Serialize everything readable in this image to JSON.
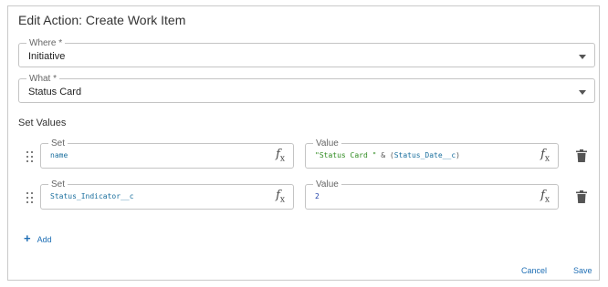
{
  "dialog": {
    "title": "Edit Action: Create Work Item"
  },
  "where": {
    "label": "Where *",
    "value": "Initiative"
  },
  "what": {
    "label": "What *",
    "value": "Status Card"
  },
  "set_values": {
    "heading": "Set Values",
    "rows": [
      {
        "set_label": "Set",
        "set_value": "name",
        "value_label": "Value",
        "value_parts": [
          "\"Status Card \"",
          " & (",
          "Status_Date__c",
          ")"
        ]
      },
      {
        "set_label": "Set",
        "set_value": "Status_Indicator__c",
        "value_label": "Value",
        "value_parts": [
          "2"
        ]
      }
    ]
  },
  "fx_icon": {
    "main": "f",
    "sub": "x"
  },
  "add_label": "Add",
  "actions": {
    "cancel": "Cancel",
    "save": "Save"
  },
  "colors": {
    "string": "#2e8b1f",
    "field": "#1a6f9e",
    "number": "#1e3fa8",
    "operator": "#555555",
    "accent": "#1f6fb5"
  }
}
